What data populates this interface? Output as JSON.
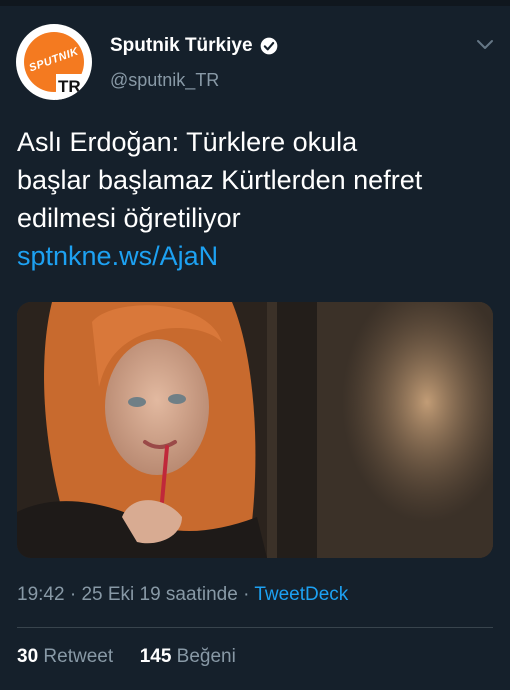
{
  "tweet": {
    "avatar": {
      "logo_text": "SPUTNIK",
      "badge_text": "TR"
    },
    "display_name": "Sputnik Türkiye",
    "handle": "@sputnik_TR",
    "text_lines": [
      "Aslı Erdoğan: Türklere okula",
      "başlar başlamaz Kürtlerden nefret",
      "edilmesi öğretiliyor"
    ],
    "link": "sptnkne.ws/AjaN",
    "time": "19:42",
    "date": "25 Eki 19 saatinde",
    "separator": "·",
    "source": "TweetDeck",
    "retweet_count": "30",
    "retweet_label": "Retweet",
    "like_count": "145",
    "like_label": "Beğeni"
  },
  "colors": {
    "background": "#15202b",
    "link": "#1da1f2",
    "muted": "#8899a6",
    "brand_orange": "#f47a20"
  }
}
